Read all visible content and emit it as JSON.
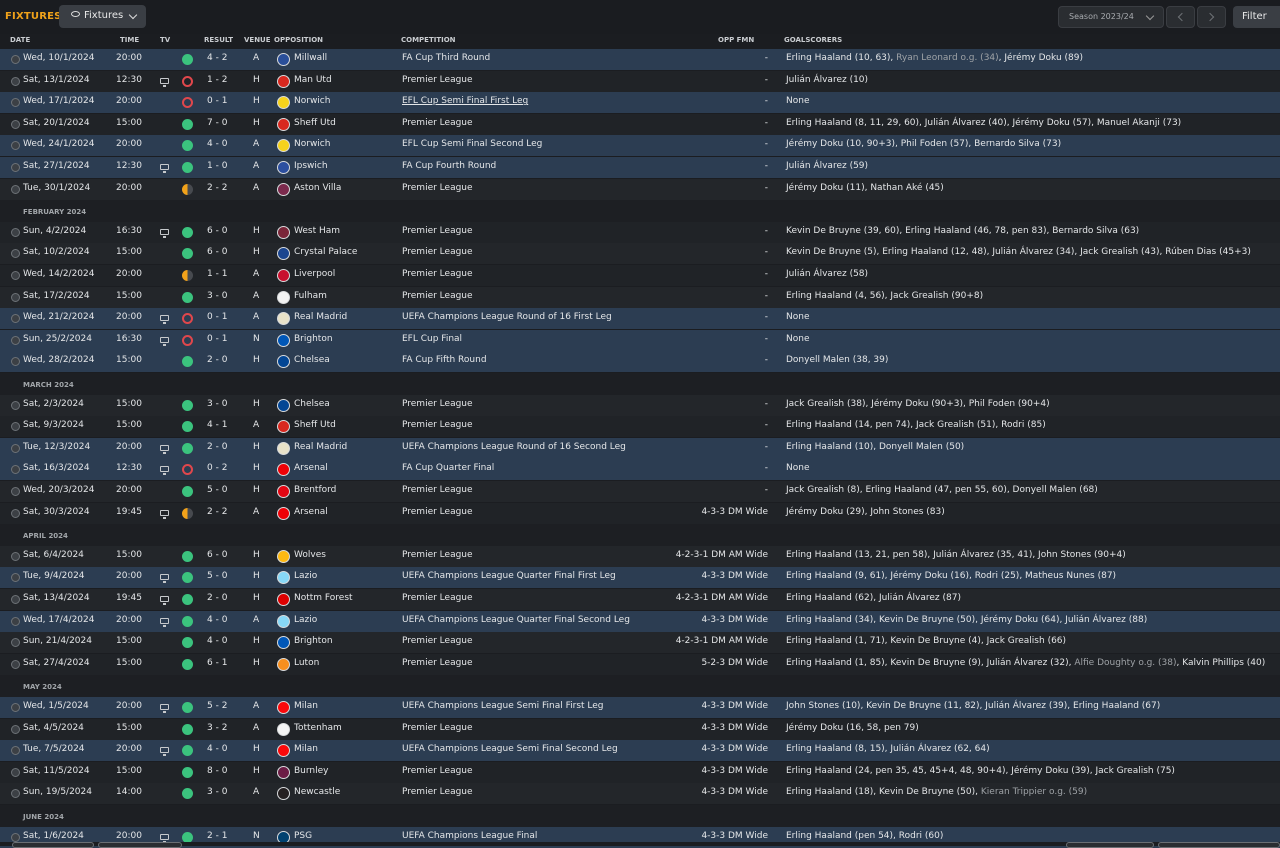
{
  "topbar": {
    "title": "FIXTURES",
    "view_label": "Fixtures",
    "season_label": "Season 2023/24",
    "filter_label": "Filter"
  },
  "headers": {
    "date": "DATE",
    "time": "TIME",
    "tv": "TV",
    "result": "RESULT",
    "venue": "VENUE",
    "opposition": "OPPOSITION",
    "competition": "COMPETITION",
    "opp_fmn": "OPP FMN",
    "goalscorers": "GOALSCORERS"
  },
  "colors": {
    "accent": "#f0a21a",
    "win": "#3bc37e",
    "loss": "#e0474c",
    "draw": "#f2a21a",
    "highlight_row": "#2c3d52"
  },
  "items": [
    {
      "kind": "match",
      "date": "Wed, 10/1/2024",
      "time": "20:00",
      "tv": false,
      "outcome": "W",
      "score": "4 - 2",
      "venue": "A",
      "opp": "Millwall",
      "crest": "#2a4f9a",
      "comp": "FA Cup Third Round",
      "fmn": "-",
      "scorers": [
        {
          "t": "Erling Haaland (10, 63), "
        },
        {
          "t": "Ryan Leonard o.g. (34)",
          "og": true
        },
        {
          "t": ", Jérémy Doku (89)"
        }
      ],
      "hl": true
    },
    {
      "kind": "match",
      "date": "Sat, 13/1/2024",
      "time": "12:30",
      "tv": true,
      "outcome": "L",
      "score": "1 - 2",
      "venue": "H",
      "opp": "Man Utd",
      "crest": "#d8281f",
      "comp": "Premier League",
      "fmn": "-",
      "scorers": [
        {
          "t": "Julián Álvarez (10)"
        }
      ]
    },
    {
      "kind": "match",
      "date": "Wed, 17/1/2024",
      "time": "20:00",
      "tv": false,
      "outcome": "L",
      "score": "0 - 1",
      "venue": "H",
      "opp": "Norwich",
      "crest": "#f5d21c",
      "comp": "EFL Cup Semi Final First Leg",
      "fmn": "-",
      "scorers": [
        {
          "t": "None"
        }
      ],
      "hl": true,
      "ul": true
    },
    {
      "kind": "match",
      "date": "Sat, 20/1/2024",
      "time": "15:00",
      "tv": false,
      "outcome": "W",
      "score": "7 - 0",
      "venue": "H",
      "opp": "Sheff Utd",
      "crest": "#d8281f",
      "comp": "Premier League",
      "fmn": "-",
      "scorers": [
        {
          "t": "Erling Haaland (8, 11, 29, 60), Julián Álvarez (40), Jérémy Doku (57), Manuel Akanji (73)"
        }
      ]
    },
    {
      "kind": "match",
      "date": "Wed, 24/1/2024",
      "time": "20:00",
      "tv": false,
      "outcome": "W",
      "score": "4 - 0",
      "venue": "A",
      "opp": "Norwich",
      "crest": "#f5d21c",
      "comp": "EFL Cup Semi Final Second Leg",
      "fmn": "-",
      "scorers": [
        {
          "t": "Jérémy Doku (10, 90+3), Phil Foden (57), Bernardo Silva (73)"
        }
      ],
      "hl": true
    },
    {
      "kind": "match",
      "date": "Sat, 27/1/2024",
      "time": "12:30",
      "tv": true,
      "outcome": "W",
      "score": "1 - 0",
      "venue": "A",
      "opp": "Ipswich",
      "crest": "#2c4fa0",
      "comp": "FA Cup Fourth Round",
      "fmn": "-",
      "scorers": [
        {
          "t": "Julián Álvarez (59)"
        }
      ],
      "hl": true
    },
    {
      "kind": "match",
      "date": "Tue, 30/1/2024",
      "time": "20:00",
      "tv": false,
      "outcome": "D",
      "score": "2 - 2",
      "venue": "A",
      "opp": "Aston Villa",
      "crest": "#7b2a4d",
      "comp": "Premier League",
      "fmn": "-",
      "scorers": [
        {
          "t": "Jérémy Doku (11), Nathan Aké (45)"
        }
      ]
    },
    {
      "kind": "month",
      "label": "FEBRUARY 2024"
    },
    {
      "kind": "match",
      "date": "Sun, 4/2/2024",
      "time": "16:30",
      "tv": true,
      "outcome": "W",
      "score": "6 - 0",
      "venue": "H",
      "opp": "West Ham",
      "crest": "#7a2639",
      "comp": "Premier League",
      "fmn": "-",
      "scorers": [
        {
          "t": "Kevin De Bruyne (39, 60), Erling Haaland (46, 78, pen 83), Bernardo Silva (63)"
        }
      ]
    },
    {
      "kind": "match",
      "date": "Sat, 10/2/2024",
      "time": "15:00",
      "tv": false,
      "outcome": "W",
      "score": "6 - 0",
      "venue": "H",
      "opp": "Crystal Palace",
      "crest": "#1b458f",
      "comp": "Premier League",
      "fmn": "-",
      "scorers": [
        {
          "t": "Kevin De Bruyne (5), Erling Haaland (12, 48), Julián Álvarez (34), Jack Grealish (43), Rúben Dias (45+3)"
        }
      ]
    },
    {
      "kind": "match",
      "date": "Wed, 14/2/2024",
      "time": "20:00",
      "tv": false,
      "outcome": "D",
      "score": "1 - 1",
      "venue": "A",
      "opp": "Liverpool",
      "crest": "#c8102e",
      "comp": "Premier League",
      "fmn": "-",
      "scorers": [
        {
          "t": "Julián Álvarez (58)"
        }
      ]
    },
    {
      "kind": "match",
      "date": "Sat, 17/2/2024",
      "time": "15:00",
      "tv": false,
      "outcome": "W",
      "score": "3 - 0",
      "venue": "A",
      "opp": "Fulham",
      "crest": "#f2f2f2",
      "comp": "Premier League",
      "fmn": "-",
      "scorers": [
        {
          "t": "Erling Haaland (4, 56), Jack Grealish (90+8)"
        }
      ]
    },
    {
      "kind": "match",
      "date": "Wed, 21/2/2024",
      "time": "20:00",
      "tv": true,
      "outcome": "L",
      "score": "0 - 1",
      "venue": "A",
      "opp": "Real Madrid",
      "crest": "#e8e2c8",
      "comp": "UEFA Champions League Round of 16 First Leg",
      "fmn": "-",
      "scorers": [
        {
          "t": "None"
        }
      ],
      "hl": true
    },
    {
      "kind": "match",
      "date": "Sun, 25/2/2024",
      "time": "16:30",
      "tv": true,
      "outcome": "L",
      "score": "0 - 1",
      "venue": "N",
      "opp": "Brighton",
      "crest": "#0057b8",
      "comp": "EFL Cup Final",
      "fmn": "-",
      "scorers": [
        {
          "t": "None"
        }
      ],
      "hl": true
    },
    {
      "kind": "match",
      "date": "Wed, 28/2/2024",
      "time": "15:00",
      "tv": false,
      "outcome": "W",
      "score": "2 - 0",
      "venue": "H",
      "opp": "Chelsea",
      "crest": "#034694",
      "comp": "FA Cup Fifth Round",
      "fmn": "-",
      "scorers": [
        {
          "t": "Donyell Malen (38, 39)"
        }
      ],
      "hl": true
    },
    {
      "kind": "month",
      "label": "MARCH 2024"
    },
    {
      "kind": "match",
      "date": "Sat, 2/3/2024",
      "time": "15:00",
      "tv": false,
      "outcome": "W",
      "score": "3 - 0",
      "venue": "H",
      "opp": "Chelsea",
      "crest": "#034694",
      "comp": "Premier League",
      "fmn": "-",
      "scorers": [
        {
          "t": "Jack Grealish (38), Jérémy Doku (90+3), Phil Foden (90+4)"
        }
      ]
    },
    {
      "kind": "match",
      "date": "Sat, 9/3/2024",
      "time": "15:00",
      "tv": false,
      "outcome": "W",
      "score": "4 - 1",
      "venue": "A",
      "opp": "Sheff Utd",
      "crest": "#d8281f",
      "comp": "Premier League",
      "fmn": "-",
      "scorers": [
        {
          "t": "Erling Haaland (14, pen 74), Jack Grealish (51), Rodri (85)"
        }
      ]
    },
    {
      "kind": "match",
      "date": "Tue, 12/3/2024",
      "time": "20:00",
      "tv": true,
      "outcome": "W",
      "score": "2 - 0",
      "venue": "H",
      "opp": "Real Madrid",
      "crest": "#e8e2c8",
      "comp": "UEFA Champions League Round of 16 Second Leg",
      "fmn": "-",
      "scorers": [
        {
          "t": "Erling Haaland (10), Donyell Malen (50)"
        }
      ],
      "hl": true
    },
    {
      "kind": "match",
      "date": "Sat, 16/3/2024",
      "time": "12:30",
      "tv": true,
      "outcome": "L",
      "score": "0 - 2",
      "venue": "H",
      "opp": "Arsenal",
      "crest": "#ef0107",
      "comp": "FA Cup Quarter Final",
      "fmn": "-",
      "scorers": [
        {
          "t": "None"
        }
      ],
      "hl": true
    },
    {
      "kind": "match",
      "date": "Wed, 20/3/2024",
      "time": "20:00",
      "tv": false,
      "outcome": "W",
      "score": "5 - 0",
      "venue": "H",
      "opp": "Brentford",
      "crest": "#e30613",
      "comp": "Premier League",
      "fmn": "-",
      "scorers": [
        {
          "t": "Jack Grealish (8), Erling Haaland (47, pen 55, 60), Donyell Malen (68)"
        }
      ]
    },
    {
      "kind": "match",
      "date": "Sat, 30/3/2024",
      "time": "19:45",
      "tv": true,
      "outcome": "D",
      "score": "2 - 2",
      "venue": "A",
      "opp": "Arsenal",
      "crest": "#ef0107",
      "comp": "Premier League",
      "fmn": "4-3-3 DM Wide",
      "scorers": [
        {
          "t": "Jérémy Doku (29), John Stones (83)"
        }
      ]
    },
    {
      "kind": "month",
      "label": "APRIL 2024"
    },
    {
      "kind": "match",
      "date": "Sat, 6/4/2024",
      "time": "15:00",
      "tv": false,
      "outcome": "W",
      "score": "6 - 0",
      "venue": "H",
      "opp": "Wolves",
      "crest": "#fdb913",
      "comp": "Premier League",
      "fmn": "4-2-3-1 DM AM Wide",
      "scorers": [
        {
          "t": "Erling Haaland (13, 21, pen 58), Julián Álvarez (35, 41), John Stones (90+4)"
        }
      ]
    },
    {
      "kind": "match",
      "date": "Tue, 9/4/2024",
      "time": "20:00",
      "tv": true,
      "outcome": "W",
      "score": "5 - 0",
      "venue": "H",
      "opp": "Lazio",
      "crest": "#87d8f7",
      "comp": "UEFA Champions League Quarter Final First Leg",
      "fmn": "4-3-3 DM Wide",
      "scorers": [
        {
          "t": "Erling Haaland (9, 61), Jérémy Doku (16), Rodri (25), Matheus Nunes (87)"
        }
      ],
      "hl": true
    },
    {
      "kind": "match",
      "date": "Sat, 13/4/2024",
      "time": "19:45",
      "tv": true,
      "outcome": "W",
      "score": "2 - 0",
      "venue": "H",
      "opp": "Nottm Forest",
      "crest": "#dd0000",
      "comp": "Premier League",
      "fmn": "4-2-3-1 DM AM Wide",
      "scorers": [
        {
          "t": "Erling Haaland (62), Julián Álvarez (87)"
        }
      ]
    },
    {
      "kind": "match",
      "date": "Wed, 17/4/2024",
      "time": "20:00",
      "tv": true,
      "outcome": "W",
      "score": "4 - 0",
      "venue": "A",
      "opp": "Lazio",
      "crest": "#87d8f7",
      "comp": "UEFA Champions League Quarter Final Second Leg",
      "fmn": "4-3-3 DM Wide",
      "scorers": [
        {
          "t": "Erling Haaland (34), Kevin De Bruyne (50), Jérémy Doku (64), Julián Álvarez (88)"
        }
      ],
      "hl": true
    },
    {
      "kind": "match",
      "date": "Sun, 21/4/2024",
      "time": "15:00",
      "tv": false,
      "outcome": "W",
      "score": "4 - 0",
      "venue": "H",
      "opp": "Brighton",
      "crest": "#0057b8",
      "comp": "Premier League",
      "fmn": "4-2-3-1 DM AM Wide",
      "scorers": [
        {
          "t": "Erling Haaland (1, 71), Kevin De Bruyne (4), Jack Grealish (66)"
        }
      ]
    },
    {
      "kind": "match",
      "date": "Sat, 27/4/2024",
      "time": "15:00",
      "tv": false,
      "outcome": "W",
      "score": "6 - 1",
      "venue": "H",
      "opp": "Luton",
      "crest": "#f78f1e",
      "comp": "Premier League",
      "fmn": "5-2-3 DM Wide",
      "scorers": [
        {
          "t": "Erling Haaland (1, 85), Kevin De Bruyne (9), Julián Álvarez (32), "
        },
        {
          "t": "Alfie Doughty o.g. (38)",
          "og": true
        },
        {
          "t": ", Kalvin Phillips (40)"
        }
      ]
    },
    {
      "kind": "month",
      "label": "MAY 2024"
    },
    {
      "kind": "match",
      "date": "Wed, 1/5/2024",
      "time": "20:00",
      "tv": true,
      "outcome": "W",
      "score": "5 - 2",
      "venue": "A",
      "opp": "Milan",
      "crest": "#fb090b",
      "comp": "UEFA Champions League Semi Final First Leg",
      "fmn": "4-3-3 DM Wide",
      "scorers": [
        {
          "t": "John Stones (10), Kevin De Bruyne (11, 82), Julián Álvarez (39), Erling Haaland (67)"
        }
      ],
      "hl": true
    },
    {
      "kind": "match",
      "date": "Sat, 4/5/2024",
      "time": "15:00",
      "tv": false,
      "outcome": "W",
      "score": "3 - 2",
      "venue": "A",
      "opp": "Tottenham",
      "crest": "#f4f4f4",
      "comp": "Premier League",
      "fmn": "4-3-3 DM Wide",
      "scorers": [
        {
          "t": "Jérémy Doku (16, 58, pen 79)"
        }
      ]
    },
    {
      "kind": "match",
      "date": "Tue, 7/5/2024",
      "time": "20:00",
      "tv": true,
      "outcome": "W",
      "score": "4 - 0",
      "venue": "H",
      "opp": "Milan",
      "crest": "#fb090b",
      "comp": "UEFA Champions League Semi Final Second Leg",
      "fmn": "4-3-3 DM Wide",
      "scorers": [
        {
          "t": "Erling Haaland (8, 15), Julián Álvarez (62, 64)"
        }
      ],
      "hl": true
    },
    {
      "kind": "match",
      "date": "Sat, 11/5/2024",
      "time": "15:00",
      "tv": false,
      "outcome": "W",
      "score": "8 - 0",
      "venue": "H",
      "opp": "Burnley",
      "crest": "#6c1d45",
      "comp": "Premier League",
      "fmn": "4-3-3 DM Wide",
      "scorers": [
        {
          "t": "Erling Haaland (24, pen 35, 45, 45+4, 48, 90+4), Jérémy Doku (39), Jack Grealish (75)"
        }
      ]
    },
    {
      "kind": "match",
      "date": "Sun, 19/5/2024",
      "time": "14:00",
      "tv": false,
      "outcome": "W",
      "score": "3 - 0",
      "venue": "A",
      "opp": "Newcastle",
      "crest": "#241f20",
      "comp": "Premier League",
      "fmn": "4-3-3 DM Wide",
      "scorers": [
        {
          "t": "Erling Haaland (18), Kevin De Bruyne (50), "
        },
        {
          "t": "Kieran Trippier o.g. (59)",
          "og": true
        }
      ]
    },
    {
      "kind": "month",
      "label": "JUNE 2024"
    },
    {
      "kind": "match",
      "date": "Sat, 1/6/2024",
      "time": "20:00",
      "tv": true,
      "outcome": "W",
      "score": "2 - 1",
      "venue": "N",
      "opp": "PSG",
      "crest": "#004170",
      "comp": "UEFA Champions League Final",
      "fmn": "4-3-3 DM Wide",
      "scorers": [
        {
          "t": "Erling Haaland (pen 54), Rodri (60)"
        }
      ],
      "hl": true
    }
  ]
}
